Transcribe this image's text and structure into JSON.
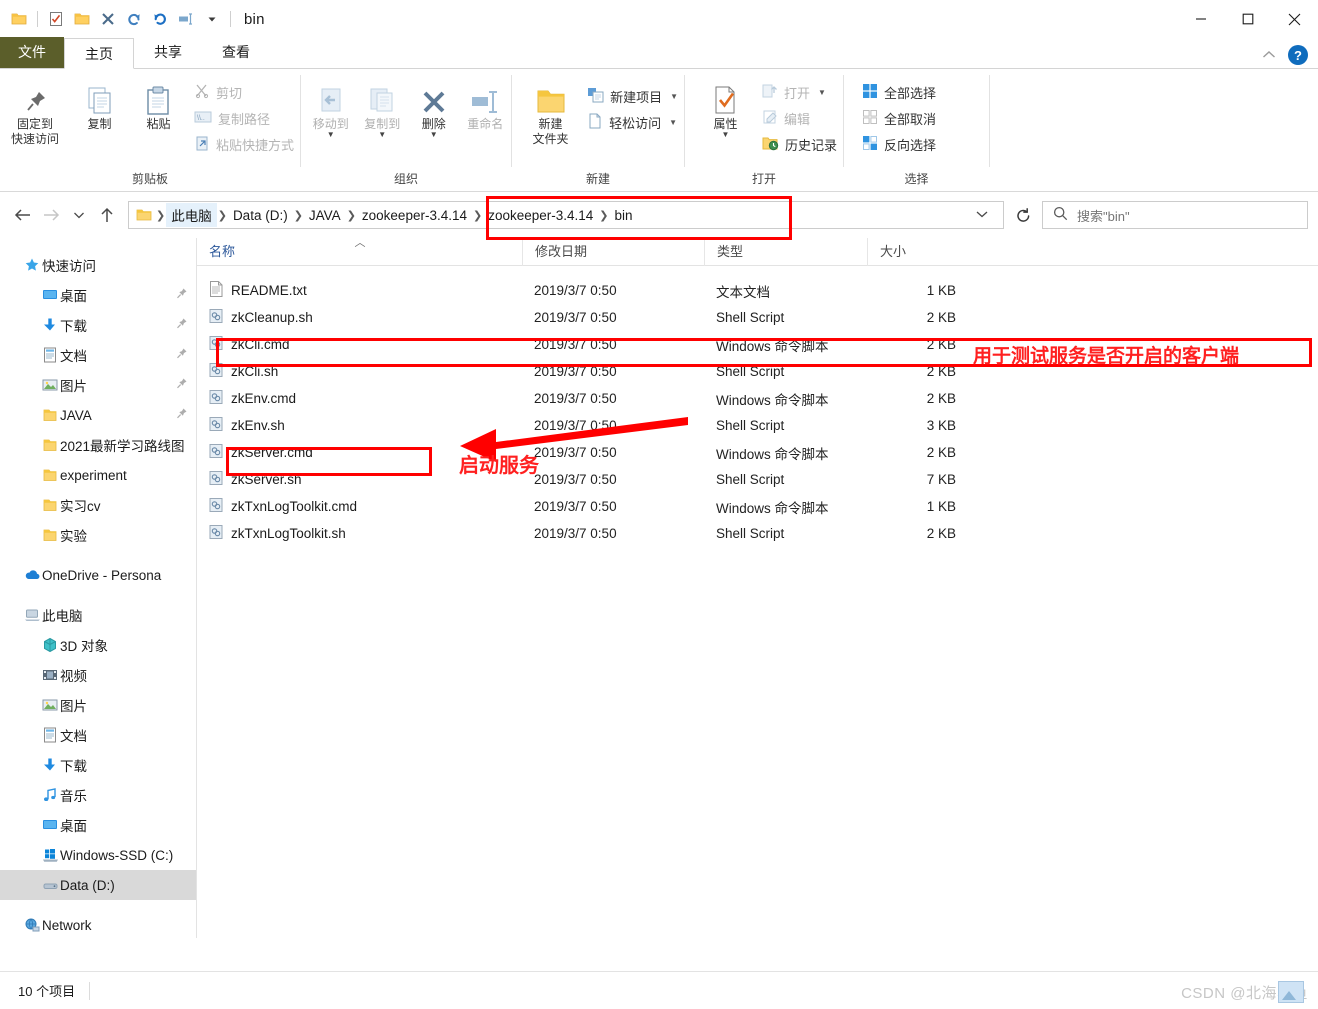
{
  "window": {
    "title": "bin",
    "quick_access": [
      "folder-icon",
      "properties-icon",
      "new-folder-icon",
      "delete-icon",
      "redo-icon",
      "undo-icon",
      "rename-icon",
      "customize-dropdown-icon"
    ],
    "controls": {
      "minimize": "minimize-icon",
      "maximize": "maximize-icon",
      "close": "close-icon"
    }
  },
  "tabs": {
    "file": "文件",
    "items": [
      {
        "label": "主页",
        "active": true
      },
      {
        "label": "共享",
        "active": false
      },
      {
        "label": "查看",
        "active": false
      }
    ],
    "collapse_ribbon": "chevron-up-icon",
    "help": "?"
  },
  "ribbon": {
    "groups": [
      {
        "label": "剪贴板",
        "big": [
          {
            "label": "固定到\n快速访问",
            "icon": "pin-icon",
            "line1": "固定到",
            "line2": "快速访问"
          },
          {
            "label": "复制",
            "icon": "copy-icon"
          },
          {
            "label": "粘贴",
            "icon": "paste-icon"
          }
        ],
        "small": [
          {
            "label": "剪切",
            "icon": "scissors-icon",
            "dim": true
          },
          {
            "label": "复制路径",
            "icon": "copy-path-icon",
            "dim": true
          },
          {
            "label": "粘贴快捷方式",
            "icon": "paste-shortcut-icon",
            "dim": true
          }
        ]
      },
      {
        "label": "组织",
        "big": [
          {
            "label": "移动到",
            "icon": "move-to-icon",
            "dim": true,
            "caret": true
          },
          {
            "label": "复制到",
            "icon": "copy-to-icon",
            "dim": true,
            "caret": true
          },
          {
            "label": "删除",
            "icon": "delete-x-icon",
            "caret": true
          },
          {
            "label": "重命名",
            "icon": "rename-icon",
            "dim": true
          }
        ],
        "small": []
      },
      {
        "label": "新建",
        "big": [
          {
            "label": "新建\n文件夹",
            "icon": "new-folder-icon",
            "line1": "新建",
            "line2": "文件夹"
          }
        ],
        "small": [
          {
            "label": "新建项目",
            "icon": "new-item-icon",
            "caret": true
          },
          {
            "label": "轻松访问",
            "icon": "easy-access-icon",
            "caret": true
          }
        ]
      },
      {
        "label": "打开",
        "big": [
          {
            "label": "属性",
            "icon": "properties-icon",
            "caret": true
          }
        ],
        "small": [
          {
            "label": "打开",
            "icon": "open-icon",
            "dim": true,
            "caret": true
          },
          {
            "label": "编辑",
            "icon": "edit-icon",
            "dim": true
          },
          {
            "label": "历史记录",
            "icon": "history-icon"
          }
        ]
      },
      {
        "label": "选择",
        "big": [],
        "small": [
          {
            "label": "全部选择",
            "icon": "select-all-icon"
          },
          {
            "label": "全部取消",
            "icon": "select-none-icon"
          },
          {
            "label": "反向选择",
            "icon": "invert-selection-icon"
          }
        ]
      }
    ]
  },
  "address": {
    "back": "back-arrow-icon",
    "forward": "forward-arrow-icon",
    "recent": "chevron-down-icon",
    "up": "up-arrow-icon",
    "breadcrumbs": [
      "此电脑",
      "Data (D:)",
      "JAVA",
      "zookeeper-3.4.14",
      "zookeeper-3.4.14",
      "bin"
    ],
    "dropdown": "chevron-down-icon",
    "refresh": "refresh-icon",
    "search_placeholder": "搜索\"bin\"",
    "search_value": ""
  },
  "sidebar": {
    "sections": [
      {
        "header": {
          "label": "快速访问",
          "icon": "star-pin-icon"
        },
        "items": [
          {
            "label": "桌面",
            "icon": "desktop-icon",
            "pinned": true
          },
          {
            "label": "下载",
            "icon": "download-icon",
            "pinned": true
          },
          {
            "label": "文档",
            "icon": "documents-icon",
            "pinned": true
          },
          {
            "label": "图片",
            "icon": "pictures-icon",
            "pinned": true
          },
          {
            "label": "JAVA",
            "icon": "folder-icon",
            "pinned": true
          },
          {
            "label": "2021最新学习路线图",
            "icon": "folder-icon",
            "pinned": false
          },
          {
            "label": "experiment",
            "icon": "folder-icon",
            "pinned": false
          },
          {
            "label": "实习cv",
            "icon": "folder-icon",
            "pinned": false
          },
          {
            "label": "实验",
            "icon": "folder-icon",
            "pinned": false
          }
        ]
      },
      {
        "header": {
          "label": "OneDrive - Persona",
          "icon": "onedrive-icon"
        },
        "items": []
      },
      {
        "header": {
          "label": "此电脑",
          "icon": "this-pc-icon"
        },
        "items": [
          {
            "label": "3D 对象",
            "icon": "3d-objects-icon",
            "pinned": false
          },
          {
            "label": "视频",
            "icon": "videos-icon",
            "pinned": false
          },
          {
            "label": "图片",
            "icon": "pictures-icon",
            "pinned": false
          },
          {
            "label": "文档",
            "icon": "documents-icon",
            "pinned": false
          },
          {
            "label": "下载",
            "icon": "download-icon",
            "pinned": false
          },
          {
            "label": "音乐",
            "icon": "music-icon",
            "pinned": false
          },
          {
            "label": "桌面",
            "icon": "desktop-icon",
            "pinned": false
          },
          {
            "label": "Windows-SSD (C:)",
            "icon": "windows-drive-icon",
            "pinned": false
          },
          {
            "label": "Data (D:)",
            "icon": "drive-icon",
            "pinned": false,
            "selected": true
          }
        ]
      },
      {
        "header": {
          "label": "Network",
          "icon": "network-icon"
        },
        "items": []
      }
    ]
  },
  "filelist": {
    "columns": [
      {
        "key": "name",
        "label": "名称",
        "sorted": true
      },
      {
        "key": "date",
        "label": "修改日期",
        "sorted": false
      },
      {
        "key": "type",
        "label": "类型",
        "sorted": false
      },
      {
        "key": "size",
        "label": "大小",
        "sorted": false
      }
    ],
    "rows": [
      {
        "name": "README.txt",
        "date": "2019/3/7 0:50",
        "type": "文本文档",
        "size": "1 KB",
        "icon": "text-file-icon"
      },
      {
        "name": "zkCleanup.sh",
        "date": "2019/3/7 0:50",
        "type": "Shell Script",
        "size": "2 KB",
        "icon": "script-file-icon"
      },
      {
        "name": "zkCli.cmd",
        "date": "2019/3/7 0:50",
        "type": "Windows 命令脚本",
        "size": "2 KB",
        "icon": "script-file-icon"
      },
      {
        "name": "zkCli.sh",
        "date": "2019/3/7 0:50",
        "type": "Shell Script",
        "size": "2 KB",
        "icon": "script-file-icon"
      },
      {
        "name": "zkEnv.cmd",
        "date": "2019/3/7 0:50",
        "type": "Windows 命令脚本",
        "size": "2 KB",
        "icon": "script-file-icon"
      },
      {
        "name": "zkEnv.sh",
        "date": "2019/3/7 0:50",
        "type": "Shell Script",
        "size": "3 KB",
        "icon": "script-file-icon"
      },
      {
        "name": "zkServer.cmd",
        "date": "2019/3/7 0:50",
        "type": "Windows 命令脚本",
        "size": "2 KB",
        "icon": "script-file-icon"
      },
      {
        "name": "zkServer.sh",
        "date": "2019/3/7 0:50",
        "type": "Shell Script",
        "size": "7 KB",
        "icon": "script-file-icon"
      },
      {
        "name": "zkTxnLogToolkit.cmd",
        "date": "2019/3/7 0:50",
        "type": "Windows 命令脚本",
        "size": "1 KB",
        "icon": "script-file-icon"
      },
      {
        "name": "zkTxnLogToolkit.sh",
        "date": "2019/3/7 0:50",
        "type": "Shell Script",
        "size": "2 KB",
        "icon": "script-file-icon"
      }
    ]
  },
  "status": {
    "item_count": "10 个项目",
    "watermark": "CSDN @北海冥鱼"
  },
  "annotations": {
    "color": "#ff0000",
    "breadcrumb_box": "highlights path zookeeper-3.4.14 > zookeeper-3.4.14 > bin",
    "zkcli_row_box": "highlights zkCli.cmd row",
    "zkcli_note": "用于测试服务是否开启的客户端",
    "zkserver_box": "highlights zkServer.cmd name cell",
    "zkserver_note": "启动服务",
    "arrow": "red-arrow-pointing-left"
  }
}
